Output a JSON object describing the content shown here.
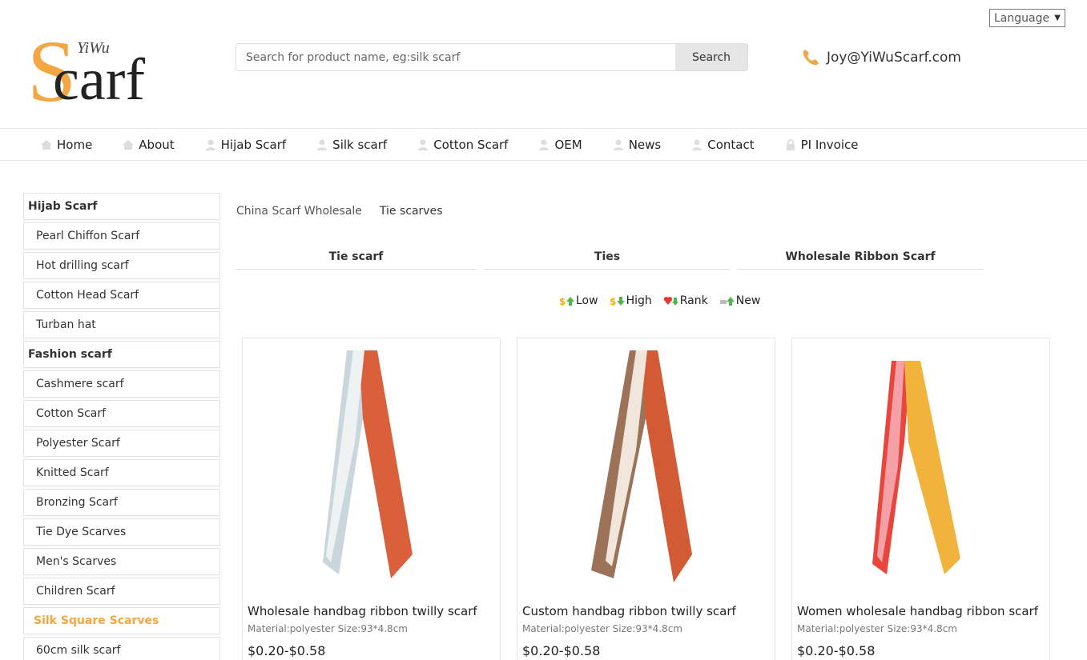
{
  "language_select": {
    "value": "Language"
  },
  "logo": {
    "small": "YiWu",
    "big_s": "S",
    "big_rest": "carf"
  },
  "search": {
    "placeholder": "Search for product name, eg:silk scarf",
    "button": "Search"
  },
  "contact": {
    "email": "Joy@YiWuScarf.com",
    "icon": "phone-icon"
  },
  "colors": {
    "accent": "#f2a742",
    "text": "#222222",
    "border": "#e6e6e6"
  },
  "nav": [
    {
      "label": "Home",
      "icon": "home-icon"
    },
    {
      "label": "About",
      "icon": "home-icon"
    },
    {
      "label": "Hijab Scarf",
      "icon": "user-icon"
    },
    {
      "label": "Silk scarf",
      "icon": "user-icon"
    },
    {
      "label": "Cotton Scarf",
      "icon": "user-icon"
    },
    {
      "label": "OEM",
      "icon": "user-icon"
    },
    {
      "label": "News",
      "icon": "user-icon"
    },
    {
      "label": "Contact",
      "icon": "user-icon"
    },
    {
      "label": "PI Invoice",
      "icon": "lock-icon"
    }
  ],
  "sidebar": [
    {
      "label": "Hijab Scarf",
      "kind": "head"
    },
    {
      "label": "Pearl Chiffon Scarf",
      "kind": "item"
    },
    {
      "label": "Hot drilling scarf",
      "kind": "item"
    },
    {
      "label": "Cotton Head Scarf",
      "kind": "item"
    },
    {
      "label": "Turban hat",
      "kind": "item"
    },
    {
      "label": "Fashion scarf",
      "kind": "head"
    },
    {
      "label": "Cashmere scarf",
      "kind": "item"
    },
    {
      "label": "Cotton Scarf",
      "kind": "item"
    },
    {
      "label": "Polyester Scarf",
      "kind": "item"
    },
    {
      "label": "Knitted Scarf",
      "kind": "item"
    },
    {
      "label": "Bronzing Scarf",
      "kind": "item"
    },
    {
      "label": "Tie Dye Scarves",
      "kind": "item"
    },
    {
      "label": "Men's Scarves",
      "kind": "item"
    },
    {
      "label": "Children Scarf",
      "kind": "item"
    },
    {
      "label": "Silk Square Scarves",
      "kind": "highlight"
    },
    {
      "label": "60cm silk scarf",
      "kind": "item"
    }
  ],
  "breadcrumb": {
    "root": "China Scarf Wholesale",
    "current": "Tie scarves"
  },
  "subcategories": [
    "Tie scarf",
    "Ties",
    "Wholesale Ribbon Scarf"
  ],
  "sort": [
    {
      "label": "Low",
      "icon": "price-up-icon"
    },
    {
      "label": "High",
      "icon": "price-down-icon"
    },
    {
      "label": "Rank",
      "icon": "heart-rank-icon"
    },
    {
      "label": "New",
      "icon": "new-arrow-icon"
    }
  ],
  "products": [
    {
      "title": "Wholesale handbag ribbon twilly scarf",
      "meta": "Material:polyester Size:93*4.8cm",
      "price": "$0.20-$0.58",
      "colors": [
        "#c9d6dc",
        "#d9603b",
        "#eef2f3"
      ]
    },
    {
      "title": "Custom handbag ribbon twilly scarf",
      "meta": "Material:polyester Size:93*4.8cm",
      "price": "$0.20-$0.58",
      "colors": [
        "#9c7258",
        "#d25a35",
        "#f1e6dc"
      ]
    },
    {
      "title": "Women wholesale handbag ribbon scarf",
      "meta": "Material:polyester Size:93*4.8cm",
      "price": "$0.20-$0.58",
      "colors": [
        "#e8453c",
        "#f2b33d",
        "#f3a0a6"
      ]
    }
  ]
}
